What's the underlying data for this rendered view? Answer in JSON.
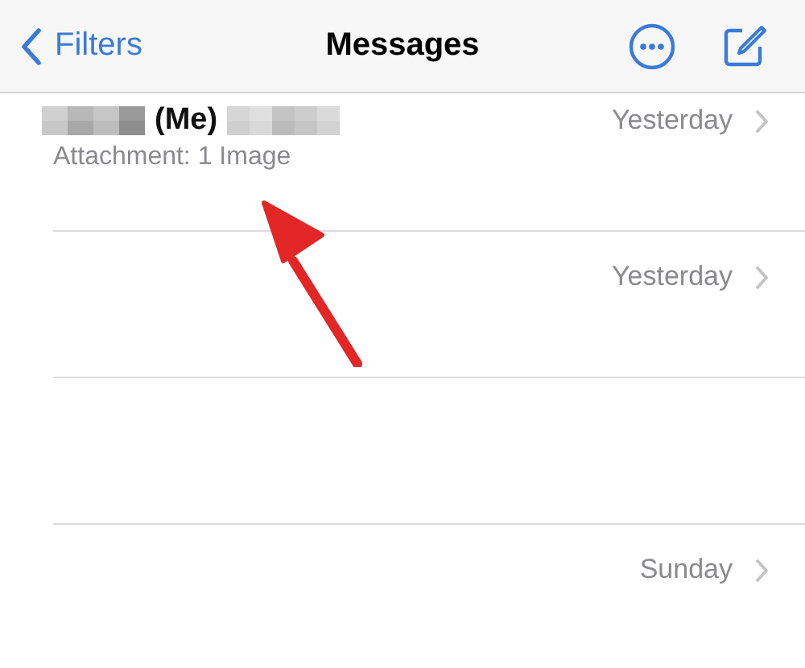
{
  "nav_bar": {
    "back_label": "Filters",
    "title": "Messages"
  },
  "messages": [
    {
      "kind": "message",
      "redacted": true,
      "sender": "(Me)",
      "preview": "Attachment: 1 Image",
      "time": "Yesterday"
    },
    {
      "kind": "message",
      "redacted": false,
      "time": "Yesterday"
    },
    {
      "kind": "blank"
    },
    {
      "kind": "message",
      "redacted": false,
      "time": "Sunday"
    }
  ],
  "annotations": [
    {
      "kind": "arrow"
    }
  ]
}
